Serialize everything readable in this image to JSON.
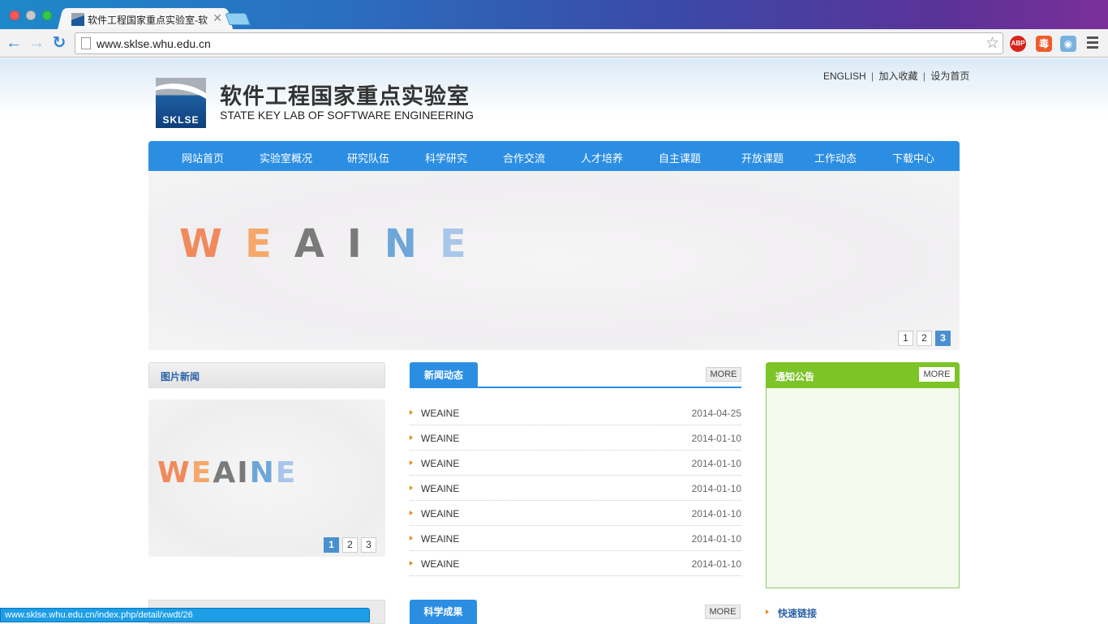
{
  "browser": {
    "tab_title": "软件工程国家重点实验室-软件",
    "tab_close": "✕",
    "url": "www.sklse.whu.edu.cn",
    "extensions": {
      "abp": "ABP",
      "red": "毒",
      "camera": "◉"
    },
    "status_url": "www.sklse.whu.edu.cn/index.php/detail/xwdt/26"
  },
  "header": {
    "logo_text": "SKLSE",
    "title": "软件工程国家重点实验室",
    "subtitle": "STATE KEY LAB OF SOFTWARE ENGINEERING",
    "top_links": {
      "english": "ENGLISH",
      "favorite": "加入收藏",
      "homepage": "设为首页",
      "sep": "|"
    }
  },
  "nav": {
    "items": [
      "网站首页",
      "实验室概况",
      "研究队伍",
      "科学研究",
      "合作交流",
      "人才培养",
      "自主课题",
      "开放课题",
      "工作动态",
      "下载中心"
    ]
  },
  "banner": {
    "word": "WEAINE",
    "pages": [
      "1",
      "2",
      "3"
    ],
    "active_page": "3"
  },
  "photo_news": {
    "title": "图片新闻",
    "word": "WEAINE",
    "pages": [
      "1",
      "2",
      "3"
    ],
    "active_page": "1"
  },
  "news": {
    "tab": "新闻动态",
    "more": "MORE",
    "items": [
      {
        "title": "WEAINE",
        "date": "2014-04-25"
      },
      {
        "title": "WEAINE",
        "date": "2014-01-10"
      },
      {
        "title": "WEAINE",
        "date": "2014-01-10"
      },
      {
        "title": "WEAINE",
        "date": "2014-01-10"
      },
      {
        "title": "WEAINE",
        "date": "2014-01-10"
      },
      {
        "title": "WEAINE",
        "date": "2014-01-10"
      },
      {
        "title": "WEAINE",
        "date": "2014-01-10"
      }
    ]
  },
  "notice": {
    "title": "通知公告",
    "more": "MORE"
  },
  "results": {
    "tab": "科学成果",
    "more": "MORE"
  },
  "quick_links": {
    "title": "快速链接"
  },
  "colors": {
    "nav_blue": "#2b8ee3",
    "notice_green": "#7cc427",
    "arrow_orange": "#e28a1b",
    "banner_letters": [
      "#f08a5d",
      "#f5a86a",
      "#7a7a7a",
      "#7a7a7a",
      "#6ea6d9",
      "#a9c6ea"
    ]
  }
}
